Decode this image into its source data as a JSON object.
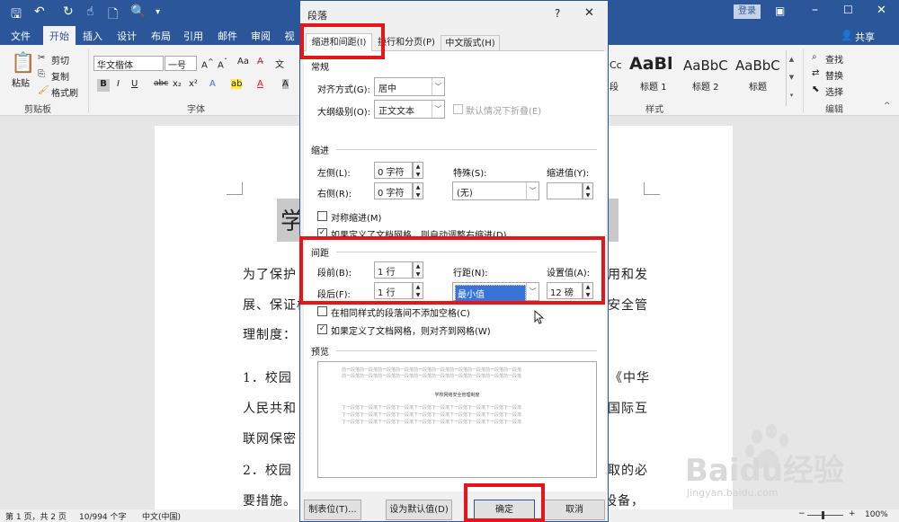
{
  "titlebar": {
    "login_label": "登录",
    "share_label": "共享"
  },
  "ribbon_tabs": [
    "文件",
    "开始",
    "插入",
    "设计",
    "布局",
    "引用",
    "邮件",
    "审阅",
    "视图"
  ],
  "ribbon": {
    "paste_label": "粘贴",
    "cut_label": "剪切",
    "copy_label": "复制",
    "format_painter_label": "格式刷",
    "clipboard_group": "剪贴板",
    "font_name": "华文楷体",
    "font_size": "一号",
    "font_group": "字体",
    "style_group": "样式",
    "styles": [
      {
        "preview": "AaBl",
        "name": "标题 1"
      },
      {
        "preview": "AaBbC",
        "name": "标题 2"
      },
      {
        "preview": "AaBbC",
        "name": "标题"
      }
    ],
    "style_partial_preview": "Cc",
    "style_partial_name": "段",
    "find_label": "查找",
    "replace_label": "替换",
    "select_label": "选择",
    "edit_group": "编辑"
  },
  "document": {
    "title_char": "学",
    "lines": [
      {
        "left": "为了保护",
        "right": "用和发"
      },
      {
        "left": "展、保证校",
        "right": "安全管"
      },
      {
        "left": "理制度：",
        "right": ""
      },
      {
        "left": "1．校园",
        "right": "《中华"
      },
      {
        "left": "人民共和",
        "right": "国际互"
      },
      {
        "left": "联网保密",
        "right": ""
      },
      {
        "left": "2．校园",
        "right": "取的必"
      },
      {
        "left": "要措施。",
        "right": "设备，"
      }
    ]
  },
  "statusbar": {
    "page_info": "第 1 页，共 2 页",
    "word_count": "10/994 个字",
    "language": "中文(中国)",
    "zoom": "100%"
  },
  "dialog": {
    "title": "段落",
    "help": "?",
    "close": "✕",
    "tabs": [
      "缩进和间距(I)",
      "换行和分页(P)",
      "中文版式(H)"
    ],
    "general": {
      "section": "常规",
      "alignment_label": "对齐方式(G):",
      "alignment_value": "居中",
      "outline_label": "大纲级别(O):",
      "outline_value": "正文文本",
      "collapsed_label": "默认情况下折叠(E)"
    },
    "indent": {
      "section": "缩进",
      "left_label": "左侧(L):",
      "left_value": "0 字符",
      "right_label": "右侧(R):",
      "right_value": "0 字符",
      "special_label": "特殊(S):",
      "special_value": "(无)",
      "indent_by_label": "缩进值(Y):",
      "indent_by_value": "",
      "mirror_label": "对称缩进(M)",
      "auto_adjust_label": "如果定义了文档网格，则自动调整右缩进(D)"
    },
    "spacing": {
      "section": "间距",
      "before_label": "段前(B):",
      "before_value": "1 行",
      "after_label": "段后(F):",
      "after_value": "1 行",
      "line_spacing_label": "行距(N):",
      "line_spacing_value": "最小值",
      "at_label": "设置值(A):",
      "at_value": "12 磅",
      "no_space_label": "在相同样式的段落间不添加空格(C)",
      "snap_grid_label": "如果定义了文档网格，则对齐到网格(W)"
    },
    "preview": {
      "section": "预览",
      "prev_para": "前一段落前一段落前一段落前一段落前一段落前一段落前一段落前一段落前一段落前一段落",
      "sample_text": "学校网络安全管理制度",
      "next_para": "下一段落下一段落下一段落下一段落下一段落下一段落下一段落下一段落下一段落下一段落"
    },
    "buttons": {
      "tabs": "制表位(T)...",
      "set_default": "设为默认值(D)",
      "ok": "确定",
      "cancel": "取消"
    }
  },
  "watermark": {
    "brand": "Baidu经验",
    "url": "jingyan.baidu.com"
  },
  "colors": {
    "ribbon_blue": "#2b579a",
    "highlight_red": "#e5151b",
    "selection_blue": "#3a73d8"
  }
}
